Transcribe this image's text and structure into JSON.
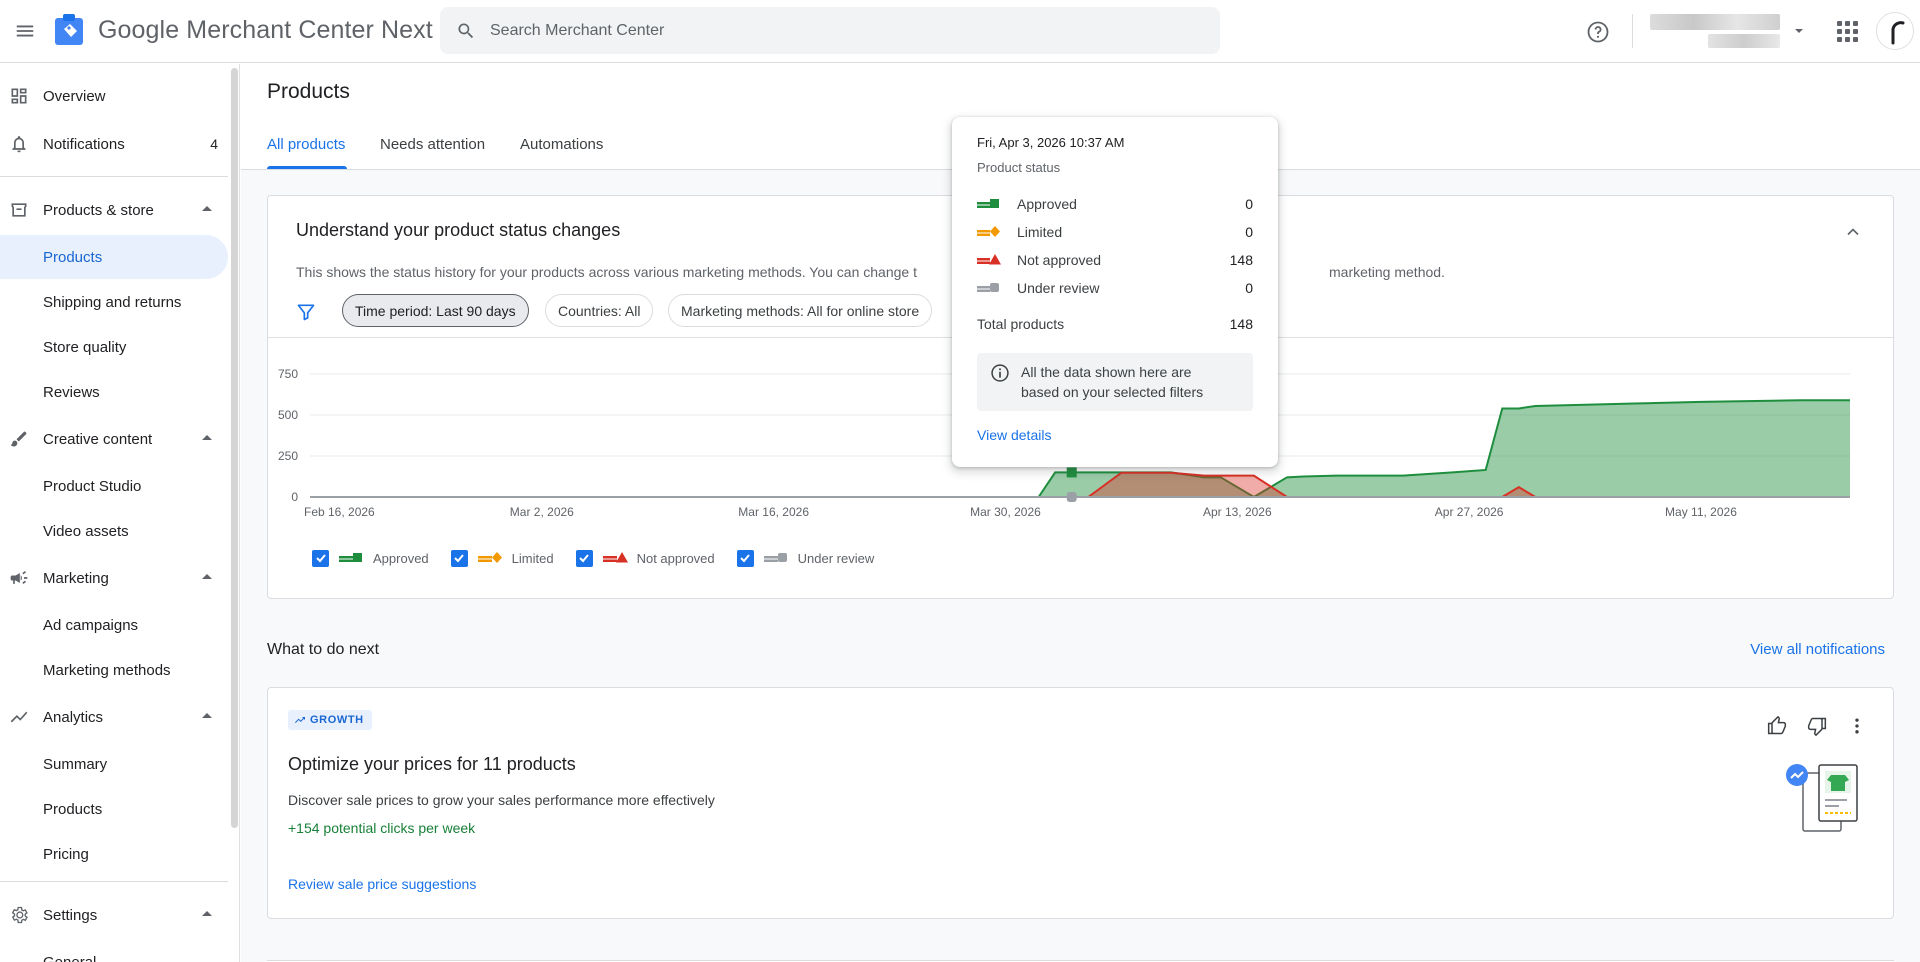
{
  "header": {
    "app_title_google": "Google",
    "app_title_rest": "Merchant Center Next",
    "search_placeholder": "Search Merchant Center"
  },
  "sidebar": {
    "overview": "Overview",
    "notifications": "Notifications",
    "notifications_count": "4",
    "products_store": "Products & store",
    "products": "Products",
    "shipping": "Shipping and returns",
    "store_quality": "Store quality",
    "reviews": "Reviews",
    "creative_content": "Creative content",
    "product_studio": "Product Studio",
    "video_assets": "Video assets",
    "marketing": "Marketing",
    "ad_campaigns": "Ad campaigns",
    "marketing_methods": "Marketing methods",
    "analytics": "Analytics",
    "summary": "Summary",
    "analytics_products": "Products",
    "pricing": "Pricing",
    "settings": "Settings",
    "general": "General"
  },
  "main": {
    "page_title": "Products",
    "tabs": [
      "All products",
      "Needs attention",
      "Automations"
    ],
    "status_card": {
      "title": "Understand your product status changes",
      "desc_left": "This shows the status history for your products across various marketing methods. You can change t",
      "desc_right": "marketing method.",
      "chips": [
        "Time period: Last 90 days",
        "Countries: All",
        "Marketing methods: All for online store"
      ]
    },
    "what_next_title": "What to do next",
    "view_all": "View all notifications",
    "recommendation": {
      "badge": "GROWTH",
      "title": "Optimize your prices for 11 products",
      "desc": "Discover sale prices to grow your sales performance more effectively",
      "metric": "+154 potential clicks per week",
      "link": "Review sale price suggestions"
    }
  },
  "tooltip": {
    "date": "Fri, Apr 3, 2026 10:37 AM",
    "subtitle": "Product status",
    "rows": [
      {
        "label": "Approved",
        "value": "0"
      },
      {
        "label": "Limited",
        "value": "0"
      },
      {
        "label": "Not approved",
        "value": "148"
      },
      {
        "label": "Under review",
        "value": "0"
      }
    ],
    "total_label": "Total products",
    "total_value": "148",
    "note": "All the data shown here are based on your selected filters",
    "link": "View details"
  },
  "colors": {
    "approved": "#1e8e3e",
    "limited": "#f29900",
    "not_approved": "#d93025",
    "under_review": "#9aa0a6",
    "accent": "#1a73e8"
  },
  "chart_data": {
    "type": "area",
    "yticks": [
      "0",
      "250",
      "500",
      "750"
    ],
    "ylim": [
      0,
      750
    ],
    "xticks": [
      "Feb 16, 2026",
      "Mar 2, 2026",
      "Mar 16, 2026",
      "Mar 30, 2026",
      "Apr 13, 2026",
      "Apr 27, 2026",
      "May 11, 2026"
    ],
    "x_day_offsets": [
      0,
      44,
      45,
      47,
      49,
      50,
      52,
      54,
      55,
      57,
      59,
      60,
      62,
      66,
      69,
      71,
      72,
      73,
      74,
      80,
      84,
      90,
      93
    ],
    "series": [
      {
        "name": "Approved",
        "values": [
          0,
          0,
          150,
          150,
          150,
          150,
          150,
          120,
          120,
          0,
          120,
          125,
          130,
          130,
          150,
          165,
          540,
          540,
          555,
          570,
          580,
          590,
          590
        ]
      },
      {
        "name": "Limited",
        "values": [
          0,
          0,
          0,
          0,
          0,
          0,
          0,
          0,
          0,
          0,
          0,
          0,
          0,
          0,
          0,
          0,
          0,
          0,
          0,
          0,
          0,
          0,
          0
        ]
      },
      {
        "name": "Not approved",
        "values": [
          0,
          0,
          0,
          0,
          148,
          148,
          148,
          130,
          130,
          130,
          0,
          0,
          0,
          0,
          0,
          0,
          0,
          60,
          0,
          0,
          0,
          0,
          0
        ]
      },
      {
        "name": "Under review",
        "values": [
          0,
          0,
          0,
          0,
          0,
          0,
          0,
          0,
          0,
          0,
          0,
          0,
          0,
          0,
          0,
          0,
          0,
          0,
          0,
          0,
          0,
          0,
          0
        ]
      }
    ],
    "legend": [
      "Approved",
      "Limited",
      "Not approved",
      "Under review"
    ]
  }
}
